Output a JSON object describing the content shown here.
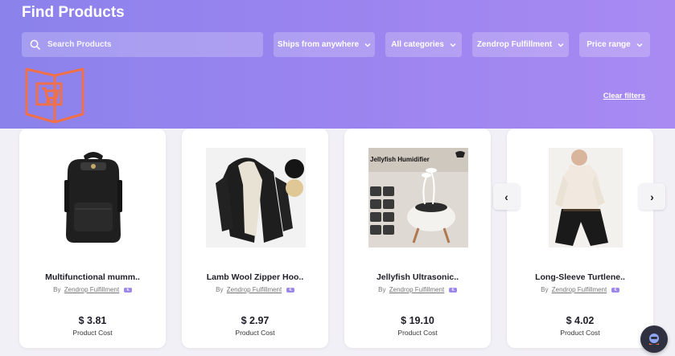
{
  "header": {
    "title": "Find Products",
    "search_placeholder": "Search Products",
    "filters": [
      "Ships from anywhere",
      "All categories",
      "Zendrop Fulfillment",
      "Price range"
    ],
    "clear_filters": "Clear filters"
  },
  "products": [
    {
      "name": "Multifunctional mumm..",
      "by": "By",
      "supplier": "Zendrop Fulfillment",
      "badge": "€",
      "price": "$ 3.81",
      "price_label": "Product Cost"
    },
    {
      "name": "Lamb Wool Zipper Hoo..",
      "by": "By",
      "supplier": "Zendrop Fulfillment",
      "badge": "€",
      "price": "$ 2.97",
      "price_label": "Product Cost"
    },
    {
      "name": "Jellyfish Ultrasonic..",
      "by": "By",
      "supplier": "Zendrop Fulfillment",
      "badge": "€",
      "price": "$ 19.10",
      "price_label": "Product Cost",
      "image_caption": "Jellyfish Humidifier"
    },
    {
      "name": "Long-Sleeve Turtlene..",
      "by": "By",
      "supplier": "Zendrop Fulfillment",
      "badge": "€",
      "price": "$ 4.02",
      "price_label": "Product Cost"
    }
  ],
  "carousel": {
    "prev": "‹",
    "next": "›"
  },
  "colors": {
    "accent": "#9b84ef",
    "badge": "#9d86ea",
    "logo": "#f0704a"
  },
  "icons": [
    "search-icon",
    "chevron-down-icon",
    "shopping-book-logo",
    "help-chat-icon"
  ]
}
